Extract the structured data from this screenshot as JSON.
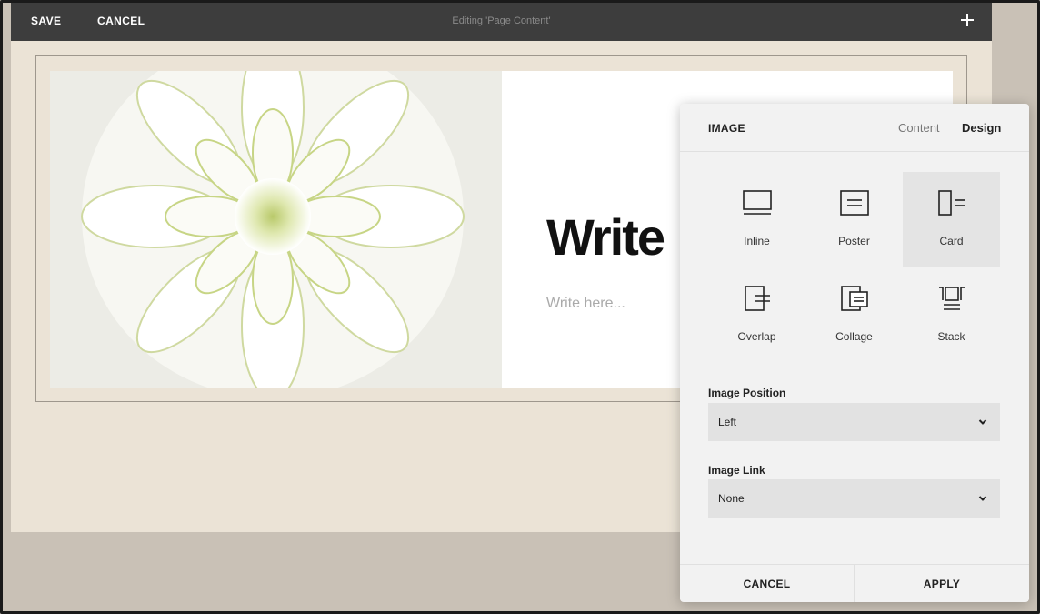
{
  "topbar": {
    "save_label": "SAVE",
    "cancel_label": "CANCEL",
    "title": "Editing 'Page Content'",
    "add_icon": "plus-icon"
  },
  "content": {
    "headline": "Write",
    "body_placeholder": "Write here..."
  },
  "panel": {
    "title": "IMAGE",
    "tabs": [
      {
        "label": "Content",
        "active": false
      },
      {
        "label": "Design",
        "active": true
      }
    ],
    "layouts": [
      {
        "label": "Inline",
        "icon": "inline-layout-icon",
        "selected": false
      },
      {
        "label": "Poster",
        "icon": "poster-layout-icon",
        "selected": false
      },
      {
        "label": "Card",
        "icon": "card-layout-icon",
        "selected": true
      },
      {
        "label": "Overlap",
        "icon": "overlap-layout-icon",
        "selected": false
      },
      {
        "label": "Collage",
        "icon": "collage-layout-icon",
        "selected": false
      },
      {
        "label": "Stack",
        "icon": "stack-layout-icon",
        "selected": false
      }
    ],
    "image_position": {
      "label": "Image Position",
      "value": "Left"
    },
    "image_link": {
      "label": "Image Link",
      "value": "None"
    },
    "footer": {
      "cancel_label": "CANCEL",
      "apply_label": "APPLY"
    }
  }
}
